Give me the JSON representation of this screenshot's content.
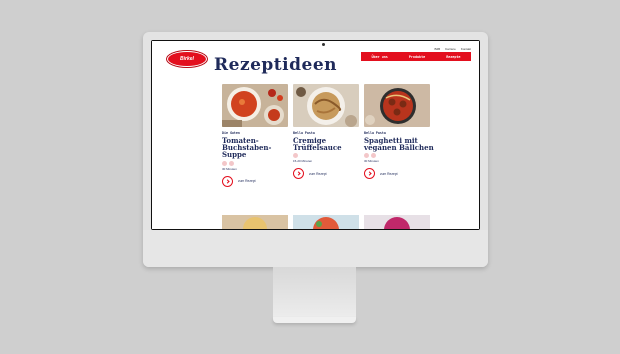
{
  "brand": {
    "logo_text": "Birkel"
  },
  "utility_links": [
    "B2B",
    "Karriere",
    "Kontakt"
  ],
  "nav": [
    "Über uns",
    "Produkte",
    "Rezepte"
  ],
  "page": {
    "title": "Rezeptideen"
  },
  "recipes": [
    {
      "tag": "Die Guten",
      "title": "Tomaten-Buchstaben-Suppe",
      "time": "30 Minuten",
      "cta": "zum Rezept"
    },
    {
      "tag": "Bella Pasta",
      "title": "Cremige Trüffelsauce",
      "time": "15-20 Minuten",
      "cta": "zum Rezept"
    },
    {
      "tag": "Bella Pasta",
      "title": "Spaghetti mit veganen Bällchen",
      "time": "30 Minuten",
      "cta": "zum Rezept"
    }
  ],
  "colors": {
    "brand_red": "#e30f1e",
    "heading_navy": "#1f2a5a",
    "icon_pink": "#f3c7c9"
  }
}
